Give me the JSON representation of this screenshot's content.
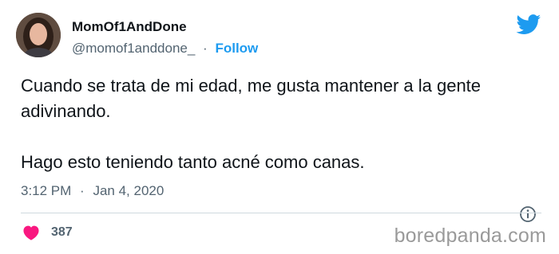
{
  "tweet": {
    "display_name": "MomOf1AndDone",
    "handle": "@momof1anddone_",
    "separator": "·",
    "follow_label": "Follow",
    "text": "Cuando se trata de mi edad, me gusta mantener a la gente adivinando.\n\nHago esto teniendo tanto acné como canas.",
    "time": "3:12 PM",
    "date": "Jan 4, 2020",
    "likes": "387"
  },
  "watermark": "boredpanda.com",
  "icons": {
    "avatar": "avatar",
    "bird": "twitter-bird-icon",
    "info": "info-icon",
    "heart": "heart-icon"
  },
  "colors": {
    "accent": "#1d9bf0",
    "text": "#0f1419",
    "muted": "#536471",
    "heart": "#f91880",
    "divider": "#cfd9de",
    "watermark": "#9a9a9a"
  }
}
